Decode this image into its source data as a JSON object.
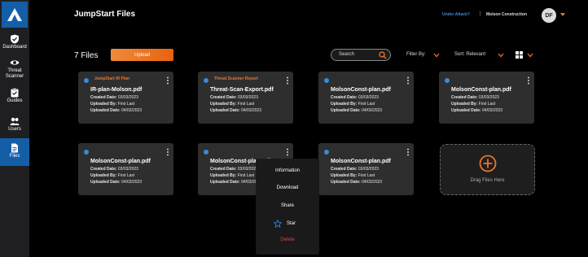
{
  "sidebar": {
    "items": [
      {
        "label": "Dashboard"
      },
      {
        "label": "Threat Scanner"
      },
      {
        "label": "Guides"
      },
      {
        "label": "Users"
      },
      {
        "label": "Files"
      }
    ]
  },
  "header": {
    "title": "JumpStart Files",
    "under_attack": "Under Attack?",
    "separator": "|",
    "organization": "Molson Construction",
    "avatar_initials": "DF"
  },
  "toolbar": {
    "file_count": "7 Files",
    "upload_label": "Upload",
    "search_label": "Search",
    "filter_label": "Filter By:",
    "sort_label": "Sort: Relevant"
  },
  "colors": {
    "accent_orange": "#e8762c",
    "brand_blue": "#145ea8",
    "link_blue": "#3a8ad8",
    "delete_red": "#e0443a"
  },
  "files": [
    {
      "tag": "JumpStart IR Plan",
      "name": "IR-plan-Molson.pdf",
      "created_label": "Created Date:",
      "created": "03/03/2023",
      "uploaded_by_label": "Uploaded By:",
      "uploaded_by": "First Last",
      "uploaded_date_label": "Uploaded Date:",
      "uploaded_date": "04/03/2023"
    },
    {
      "tag": "Threat Scanner Report",
      "name": "Threat-Scan-Export.pdf",
      "created_label": "Created Date:",
      "created": "03/03/2023",
      "uploaded_by_label": "Uploaded By:",
      "uploaded_by": "First Last",
      "uploaded_date_label": "Uploaded Date:",
      "uploaded_date": "04/03/2023"
    },
    {
      "tag": "",
      "name": "MolsonConst-plan.pdf",
      "created_label": "Created Date:",
      "created": "03/03/2023",
      "uploaded_by_label": "Uploaded By:",
      "uploaded_by": "First Last",
      "uploaded_date_label": "Uploaded Date:",
      "uploaded_date": "04/03/2023"
    },
    {
      "tag": "",
      "name": "MolsonConst-plan.pdf",
      "created_label": "Created Date:",
      "created": "03/03/2023",
      "uploaded_by_label": "Uploaded By:",
      "uploaded_by": "First Last",
      "uploaded_date_label": "Uploaded Date:",
      "uploaded_date": "04/03/2023"
    },
    {
      "tag": "",
      "name": "MolsonConst-plan.pdf",
      "created_label": "Created Date:",
      "created": "03/03/2023",
      "uploaded_by_label": "Uploaded By:",
      "uploaded_by": "First Last",
      "uploaded_date_label": "Uploaded Date:",
      "uploaded_date": "04/03/2023"
    },
    {
      "tag": "",
      "name": "MolsonConst-plan.pdf",
      "created_label": "Created Date:",
      "created": "03/03/2023",
      "uploaded_by_label": "Uploaded By:",
      "uploaded_by": "First Last",
      "uploaded_date_label": "Uploaded Date:",
      "uploaded_date": "04/03/2023"
    },
    {
      "tag": "",
      "name": "MolsonConst-plan.pdf",
      "created_label": "Created Date:",
      "created": "03/03/2023",
      "uploaded_by_label": "Uploaded By:",
      "uploaded_by": "First Last",
      "uploaded_date_label": "Uploaded Date:",
      "uploaded_date": "04/03/2023"
    }
  ],
  "dropzone": {
    "label": "Drag Files Here"
  },
  "context_menu": {
    "information": "Information",
    "download": "Download",
    "share": "Share",
    "star": "Star",
    "delete": "Delete"
  }
}
